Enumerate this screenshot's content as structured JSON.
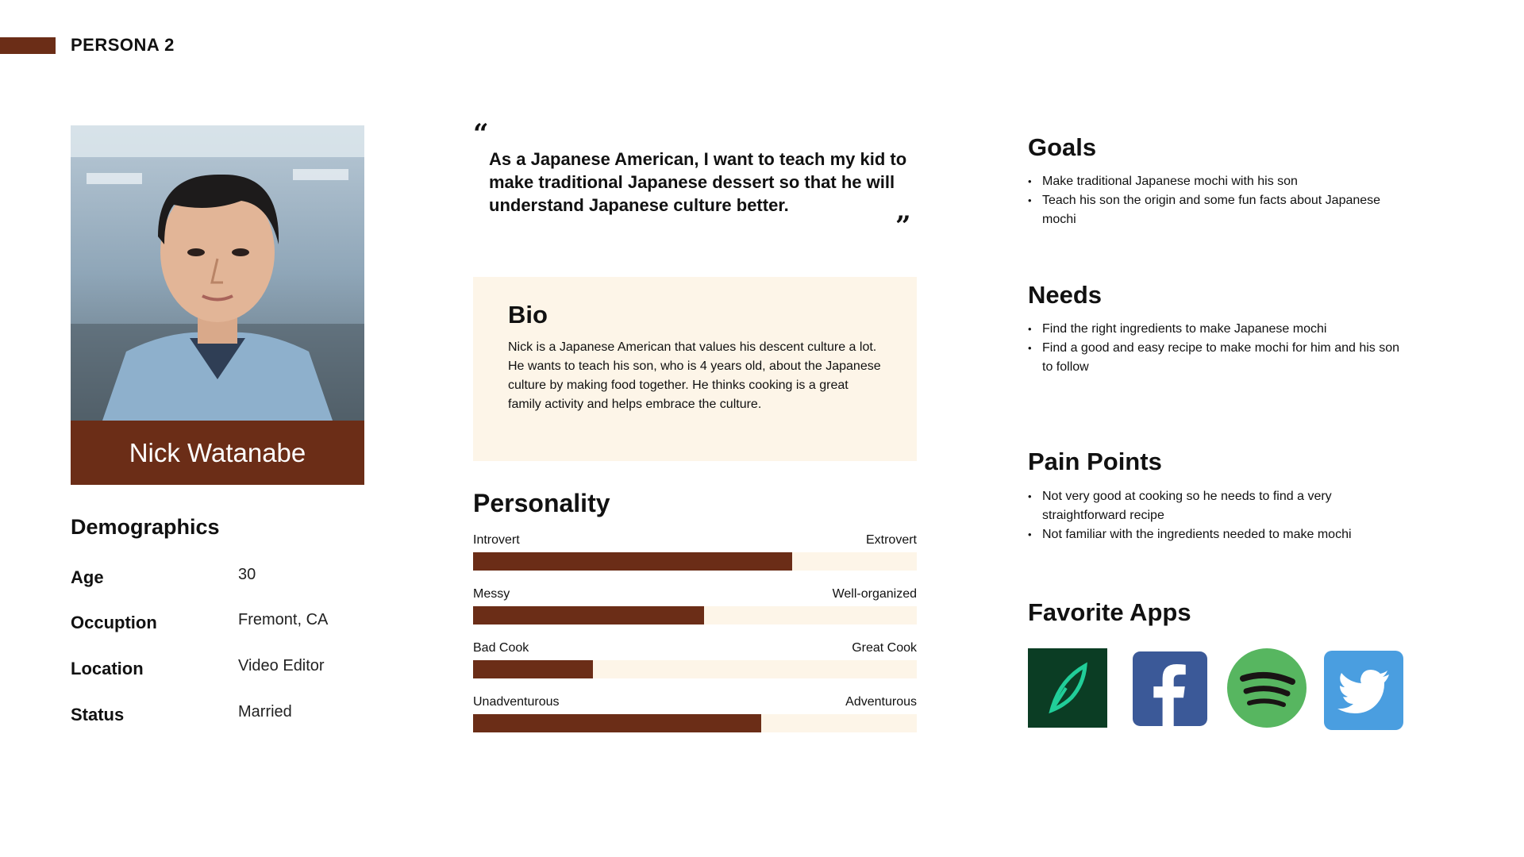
{
  "header": {
    "title": "PERSONA 2"
  },
  "persona": {
    "name": "Nick Watanabe"
  },
  "demographics": {
    "title": "Demographics",
    "rows": [
      {
        "label": "Age",
        "value": "30"
      },
      {
        "label": "Occuption",
        "value": "Fremont, CA"
      },
      {
        "label": "Location",
        "value": "Video Editor"
      },
      {
        "label": "Status",
        "value": "Married"
      }
    ]
  },
  "quote": {
    "open": "“",
    "close": "”",
    "text": "As a Japanese American, I want to teach my kid to make traditional Japanese dessert so that he will understand Japanese culture better."
  },
  "bio": {
    "title": "Bio",
    "text": "Nick is a Japanese American that values his descent culture a lot. He wants to teach his son, who is 4 years old, about the Japanese culture by making food together. He thinks cooking is a great family activity and helps embrace the culture."
  },
  "personality": {
    "title": "Personality",
    "traits": [
      {
        "left": "Introvert",
        "right": "Extrovert",
        "level": 0.72
      },
      {
        "left": "Messy",
        "right": "Well-organized",
        "level": 0.52
      },
      {
        "left": "Bad Cook",
        "right": "Great Cook",
        "level": 0.27
      },
      {
        "left": "Unadventurous",
        "right": "Adventurous",
        "level": 0.65
      }
    ]
  },
  "goals": {
    "title": "Goals",
    "items": [
      "Make traditional Japanese mochi with his son",
      "Teach his son the origin and some fun facts about Japanese mochi"
    ]
  },
  "needs": {
    "title": "Needs",
    "items": [
      "Find the right ingredients to make Japanese mochi",
      "Find a good and easy recipe to make mochi for him and his son to follow"
    ]
  },
  "pain_points": {
    "title": "Pain Points",
    "items": [
      "Not very good at cooking so he needs to find a very straightforward recipe",
      "Not familiar with the ingredients needed to make mochi"
    ]
  },
  "favorite_apps": {
    "title": "Favorite Apps",
    "apps": [
      {
        "icon": "robinhood-icon",
        "color": "#0b3d24",
        "accent": "#21ce99"
      },
      {
        "icon": "facebook-icon",
        "color": "#3b5998",
        "accent": "#ffffff"
      },
      {
        "icon": "spotify-icon",
        "color": "#57b660",
        "accent": "#191414"
      },
      {
        "icon": "twitter-icon",
        "color": "#4a9ee0",
        "accent": "#ffffff"
      }
    ]
  },
  "colors": {
    "accent": "#6b2d17",
    "cream": "#fdf5e8"
  }
}
